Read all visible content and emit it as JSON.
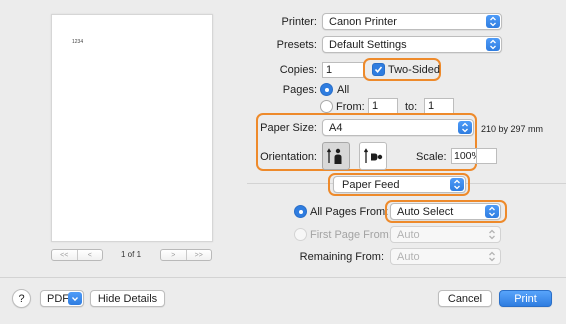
{
  "preview": {
    "page_text": "1234",
    "nav_first": "<<",
    "nav_prev": "<",
    "nav_next": ">",
    "nav_last": ">>",
    "page_indicator": "1 of 1"
  },
  "printer": {
    "label": "Printer:",
    "value": "Canon Printer"
  },
  "presets": {
    "label": "Presets:",
    "value": "Default Settings"
  },
  "copies": {
    "label": "Copies:",
    "value": "1",
    "two_sided_label": "Two-Sided",
    "two_sided_checked": true
  },
  "pages": {
    "label": "Pages:",
    "all_label": "All",
    "from_label": "From:",
    "from_value": "1",
    "to_label": "to:",
    "to_value": "1",
    "selected": "All"
  },
  "paper_size": {
    "label": "Paper Size:",
    "value": "A4",
    "dimensions": "210 by 297 mm"
  },
  "orientation": {
    "label": "Orientation:",
    "selected": "portrait"
  },
  "scale": {
    "label": "Scale:",
    "value": "100%"
  },
  "section": {
    "value": "Paper Feed"
  },
  "paper_feed": {
    "all_pages_from_label": "All Pages From:",
    "all_pages_from_value": "Auto Select",
    "first_page_from_label": "First Page From:",
    "first_page_from_value": "Auto",
    "remaining_from_label": "Remaining From:",
    "remaining_from_value": "Auto",
    "selected": "All Pages From"
  },
  "footer": {
    "help_label": "?",
    "pdf_label": "PDF",
    "hide_details_label": "Hide Details",
    "cancel_label": "Cancel",
    "print_label": "Print"
  },
  "colors": {
    "accent": "#2f7de0",
    "highlight": "#ee8a2b"
  }
}
